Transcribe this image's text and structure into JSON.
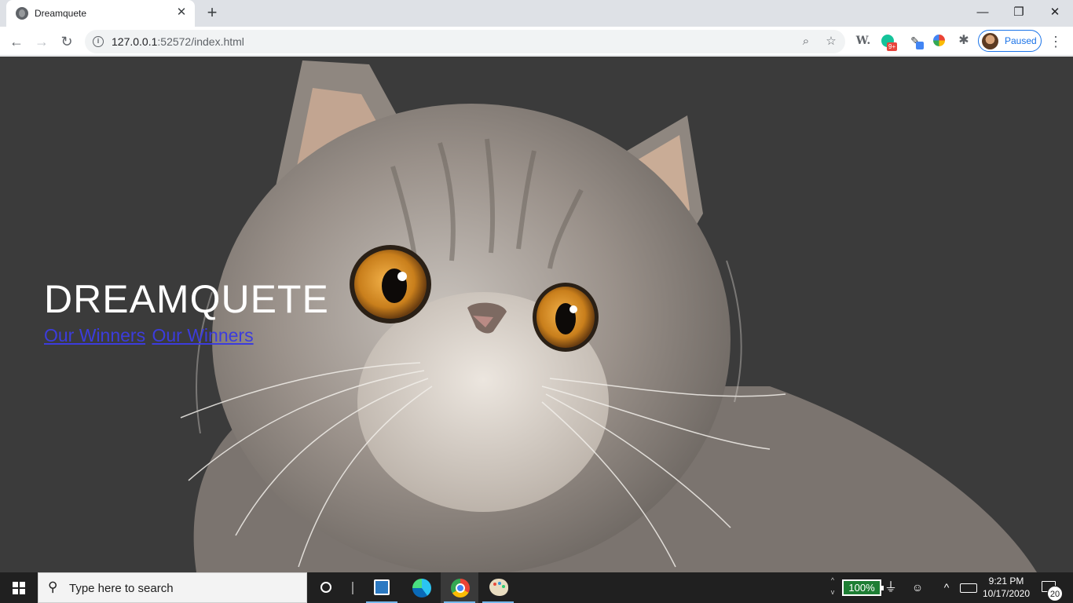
{
  "browser": {
    "tab": {
      "title": "Dreamquete",
      "close_symbol": "✕"
    },
    "new_tab_symbol": "+",
    "window_controls": {
      "minimize": "—",
      "maximize": "❐",
      "close": "✕"
    },
    "nav": {
      "back": "←",
      "forward": "→",
      "reload": "↻"
    },
    "address": {
      "host": "127.0.0.1",
      "rest": ":52572/index.html"
    },
    "omnibox_icons": {
      "zoom": "⌕",
      "star": "☆"
    },
    "extensions": {
      "w_label": "W.",
      "grammarly_badge": "9+",
      "pen": "✎",
      "puzzle": "✱"
    },
    "profile": {
      "label": "Paused"
    },
    "menu_symbol": "⋮"
  },
  "page": {
    "brand": "DREAMQUETE",
    "links": [
      "Our Winners",
      "Our Winners"
    ],
    "background_color": "#3a3a3a",
    "link_color": "#3c3cdc"
  },
  "taskbar": {
    "search_placeholder": "Type here to search",
    "battery": "100%",
    "time": "9:21 PM",
    "date": "10/17/2020",
    "notifications": "20",
    "scroll_up": "^",
    "scroll_down": "v",
    "chevron": "^"
  }
}
